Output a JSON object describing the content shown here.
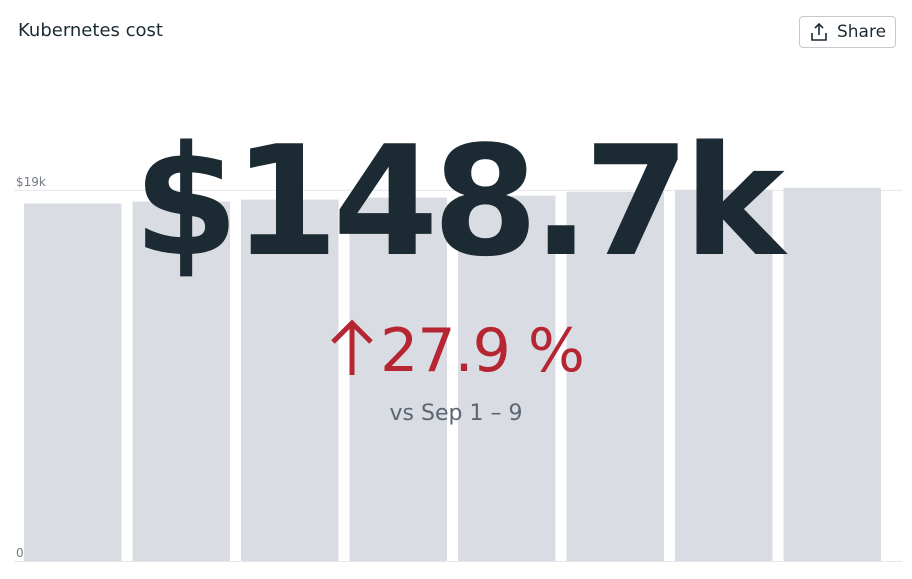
{
  "header": {
    "title": "Kubernetes cost",
    "share_label": "Share",
    "share_icon": "upload-share-icon"
  },
  "kpi": {
    "value": "$148.7k",
    "change_percent": "27.9 %",
    "change_direction": "up",
    "change_icon": "arrow-up-icon",
    "comparison": "vs Sep 1 – 9"
  },
  "colors": {
    "bar": "#d9dde3",
    "value_text": "#1c2b33",
    "change_negative": "#b52532",
    "comparison_text": "#5c6670"
  },
  "chart_data": {
    "type": "bar",
    "categories": [
      "",
      "",
      "",
      "",
      "",
      "",
      "",
      ""
    ],
    "values": [
      18.3,
      18.4,
      18.5,
      18.6,
      18.7,
      18.9,
      19.0,
      19.1
    ],
    "ylim": [
      0,
      19.4
    ],
    "yticks": [
      {
        "value": 19,
        "label": "$19k"
      },
      {
        "value": 0,
        "label": "0"
      }
    ],
    "grid": true,
    "legend": "none"
  }
}
